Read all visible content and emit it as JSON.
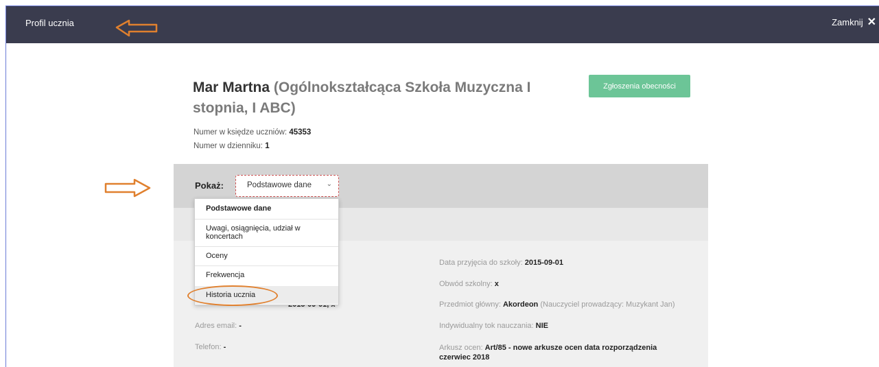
{
  "topbar": {
    "title": "Profil ucznia",
    "close_label": "Zamknij",
    "close_icon": "close-icon"
  },
  "student": {
    "name": "Mar Martna",
    "school": "(Ogólnokształcąca Szkoła Muzyczna I stopnia, I ABC)",
    "book_number_label": "Numer w księdze uczniów:",
    "book_number": "45353",
    "journal_number_label": "Numer w dzienniku:",
    "journal_number": "1"
  },
  "attendance_button": "Zgłoszenia obecności",
  "show": {
    "label": "Pokaż:",
    "selected": "Podstawowe dane",
    "options": [
      "Podstawowe dane",
      "Uwagi, osiągnięcia, udział w koncertach",
      "Oceny",
      "Frekwencja",
      "Historia ucznia"
    ]
  },
  "left_fields": {
    "birth_tail": "2015-09-01, x",
    "email_label": "Adres email:",
    "email_value": "-",
    "phone_label": "Telefon:",
    "phone_value": "-"
  },
  "right_fields": {
    "admission_label": "Data przyjęcia do szkoły:",
    "admission_value": "2015-09-01",
    "district_label": "Obwód szkolny:",
    "district_value": "x",
    "subject_label": "Przedmiot główny:",
    "subject_value": "Akordeon",
    "subject_teacher": "(Nauczyciel prowadzący: Muzykant Jan)",
    "individual_label": "Indywidualny tok nauczania:",
    "individual_value": "NIE",
    "sheet_label": "Arkusz ocen:",
    "sheet_value": "Art/85 - nowe arkusze ocen data rozporządzenia czerwiec 2018"
  },
  "colors": {
    "topbar": "#3a3c4e",
    "accent_green": "#6cc597",
    "annotation_orange": "#e0802e"
  }
}
